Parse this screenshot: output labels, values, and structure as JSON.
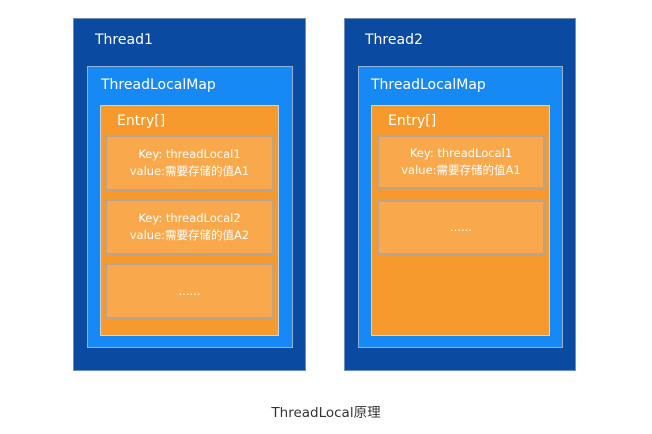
{
  "threads": [
    {
      "title": "Thread1",
      "map_title": "ThreadLocalMap",
      "entry_title": "Entry[]",
      "slots": [
        {
          "key": "Key: threadLocal1",
          "value": "value:需要存储的值A1"
        },
        {
          "key": "Key: threadLocal2",
          "value": "value:需要存储的值A2"
        },
        {
          "text": "......"
        }
      ]
    },
    {
      "title": "Thread2",
      "map_title": "ThreadLocalMap",
      "entry_title": "Entry[]",
      "slots": [
        {
          "key": "Key: threadLocal1",
          "value": "value:需要存储的值A1"
        },
        {
          "text": "......"
        }
      ]
    }
  ],
  "caption": "ThreadLocal原理",
  "colors": {
    "thread_bg": "#0a4aa0",
    "map_bg": "#1789f5",
    "entry_bg": "#f79a2e",
    "slot_bg": "#f9a84c",
    "text": "#ffffff"
  }
}
